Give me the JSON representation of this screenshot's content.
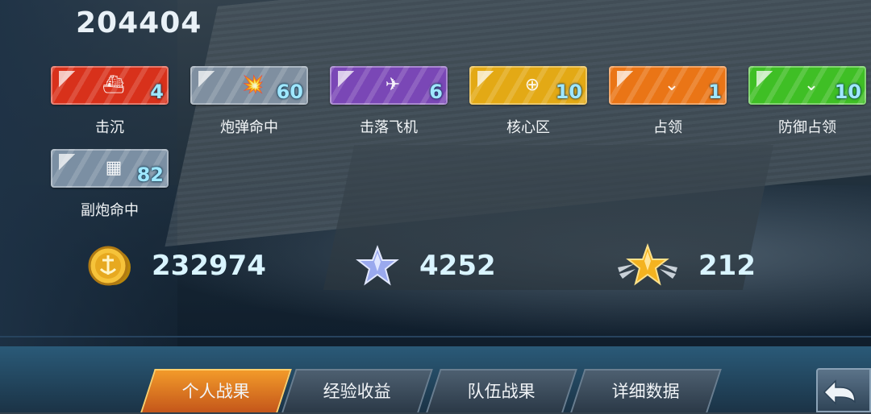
{
  "header": {
    "score": "204404"
  },
  "medals": [
    {
      "label": "击沉",
      "count": "4",
      "color": "#d8311b",
      "icon": "sinking-ship-icon",
      "glyph": "⛴"
    },
    {
      "label": "炮弹命中",
      "count": "60",
      "color": "#7f8fa0",
      "icon": "shell-hit-icon",
      "glyph": "💥"
    },
    {
      "label": "击落飞机",
      "count": "6",
      "color": "#7a47b6",
      "icon": "plane-shot-icon",
      "glyph": "✈"
    },
    {
      "label": "核心区",
      "count": "10",
      "color": "#e3a915",
      "icon": "core-zone-icon",
      "glyph": "⊕"
    },
    {
      "label": "占领",
      "count": "1",
      "color": "#ea7516",
      "icon": "capture-chevron-icon",
      "glyph": "⌄"
    },
    {
      "label": "防御占领",
      "count": "10",
      "color": "#3fbf25",
      "icon": "defend-capture-icon",
      "glyph": "⌄"
    },
    {
      "label": "副炮命中",
      "count": "82",
      "color": "#7b8fa3",
      "icon": "secondary-gun-icon",
      "glyph": "▦"
    }
  ],
  "rewards": {
    "coins": {
      "value": "232974",
      "icon": "gold-coin-icon"
    },
    "silver_star": {
      "value": "4252",
      "icon": "silver-star-icon"
    },
    "gold_star": {
      "value": "212",
      "icon": "winged-gold-star-icon"
    }
  },
  "tabs": [
    {
      "label": "个人战果",
      "active": true
    },
    {
      "label": "经验收益",
      "active": false
    },
    {
      "label": "队伍战果",
      "active": false
    },
    {
      "label": "详细数据",
      "active": false
    }
  ],
  "back_button": {
    "icon": "back-arrow-icon"
  },
  "colors": {
    "accent": "#f29a2a",
    "value_text": "#d9f4ff",
    "count_text": "#9fe7ff"
  }
}
